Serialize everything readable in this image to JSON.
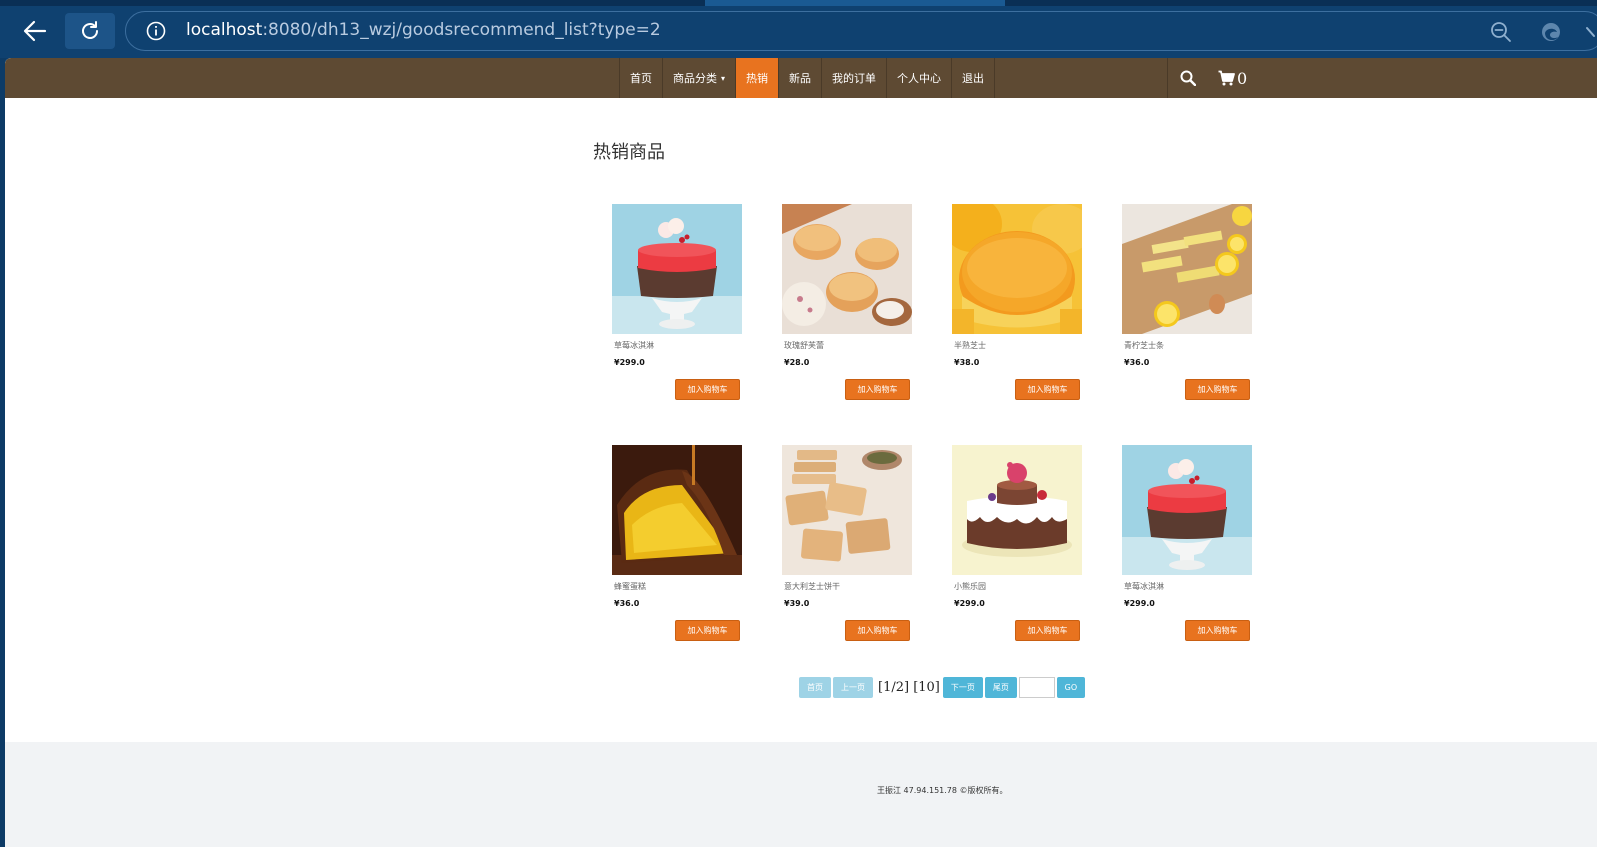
{
  "browser": {
    "url_host": "localhost",
    "url_rest": ":8080/dh13_wzj/goodsrecommend_list?type=2"
  },
  "nav": {
    "items": [
      {
        "label": "首页"
      },
      {
        "label": "商品分类"
      },
      {
        "label": "热销"
      },
      {
        "label": "新品"
      },
      {
        "label": "我的订单"
      },
      {
        "label": "个人中心"
      },
      {
        "label": "退出"
      }
    ],
    "cart_count": "0"
  },
  "section_title": "热销商品",
  "products": [
    {
      "name": "草莓冰淇淋",
      "price": "¥299.0",
      "button": "加入购物车"
    },
    {
      "name": "玫瑰舒芙蕾",
      "price": "¥28.0",
      "button": "加入购物车"
    },
    {
      "name": "半熟芝士",
      "price": "¥38.0",
      "button": "加入购物车"
    },
    {
      "name": "青柠芝士条",
      "price": "¥36.0",
      "button": "加入购物车"
    },
    {
      "name": "蜂蜜蛋糕",
      "price": "¥36.0",
      "button": "加入购物车"
    },
    {
      "name": "意大利芝士饼干",
      "price": "¥39.0",
      "button": "加入购物车"
    },
    {
      "name": "小熊乐园",
      "price": "¥299.0",
      "button": "加入购物车"
    },
    {
      "name": "草莓冰淇淋",
      "price": "¥299.0",
      "button": "加入购物车"
    }
  ],
  "pager": {
    "first": "首页",
    "prev": "上一页",
    "info": "[1/2] [10]",
    "next": "下一页",
    "last": "尾页",
    "input_value": "",
    "go": "GO"
  },
  "footer": "王振江 47.94.151.78 ©版权所有。",
  "colors": {
    "navbar": "#5e4a33",
    "accent": "#e8731f",
    "pager_enabled": "#4fb6d8",
    "pager_disabled": "#9ed3e6"
  }
}
